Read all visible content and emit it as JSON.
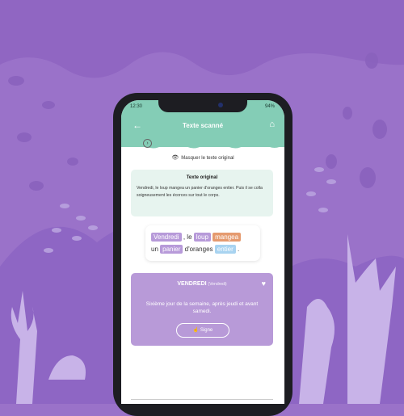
{
  "status": {
    "time": "12:30",
    "battery": "94%"
  },
  "header": {
    "title": "Texte scanné"
  },
  "hide_text": "Masquer le texte original",
  "original": {
    "heading": "Texte original",
    "text": "Vendredi, le loup mangea un panier d'oranges entier. Puis il se colla soigneusement les écorces sur tout le corps."
  },
  "sentence": {
    "w1": "Vendredi",
    "p1": ",",
    "w2": "le",
    "w3": "loup",
    "w4": "mangea",
    "w5": "un",
    "w6": "panier",
    "w7": "d'oranges",
    "w8": "entier",
    "p2": "."
  },
  "definition": {
    "word": "VENDREDI",
    "word_note": "(Vendredi)",
    "text": "Sixième jour de la semaine, après jeudi et avant samedi.",
    "button": "Signe"
  },
  "colors": {
    "background": "#9a72c9",
    "header": "#84cdb6",
    "card": "#b89ad8"
  }
}
